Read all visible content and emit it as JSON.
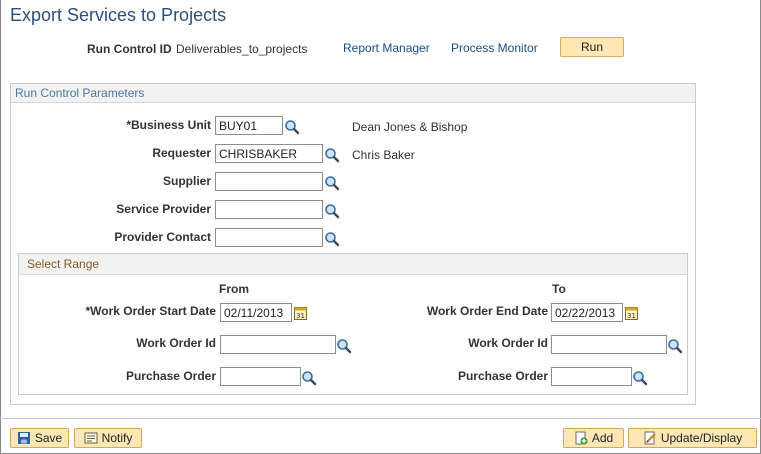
{
  "header": {
    "title": "Export Services to Projects",
    "run_control_label": "Run Control ID",
    "run_control_value": "Deliverables_to_projects",
    "report_manager": "Report Manager",
    "process_monitor": "Process Monitor",
    "run_label": "Run"
  },
  "params": {
    "title": "Run Control Parameters",
    "business_unit": {
      "label": "*Business Unit",
      "value": "BUY01",
      "description": "Dean Jones & Bishop"
    },
    "requester": {
      "label": "Requester",
      "value": "CHRISBAKER",
      "description": "Chris Baker"
    },
    "supplier": {
      "label": "Supplier",
      "value": ""
    },
    "service_provider": {
      "label": "Service Provider",
      "value": ""
    },
    "provider_contact": {
      "label": "Provider Contact",
      "value": ""
    }
  },
  "range": {
    "title": "Select Range",
    "from_header": "From",
    "to_header": "To",
    "start_date": {
      "label": "*Work Order Start Date",
      "value": "02/11/2013"
    },
    "end_date": {
      "label": "Work Order End Date",
      "value": "02/22/2013"
    },
    "from_work_order": {
      "label": "Work Order Id",
      "value": ""
    },
    "to_work_order": {
      "label": "Work Order Id",
      "value": ""
    },
    "from_po": {
      "label": "Purchase Order",
      "value": ""
    },
    "to_po": {
      "label": "Purchase Order",
      "value": ""
    }
  },
  "toolbar": {
    "save_label": "Save",
    "notify_label": "Notify",
    "add_label": "Add",
    "update_label": "Update/Display"
  },
  "colors": {
    "title": "#2b4f7e",
    "link": "#1b4d86",
    "button_bg": "#fde7b5",
    "group_header_text": "#4b77a8",
    "subgroup_header_text": "#8a5a23"
  }
}
